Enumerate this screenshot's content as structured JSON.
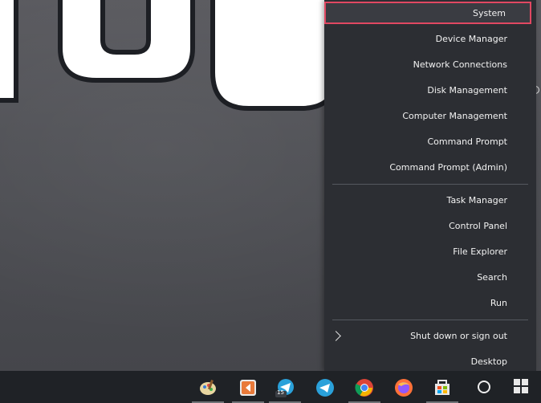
{
  "menu": {
    "items": [
      {
        "label": "System",
        "selected": true
      },
      {
        "label": "Device Manager"
      },
      {
        "label": "Network Connections"
      },
      {
        "label": "Disk Management"
      },
      {
        "label": "Computer Management"
      },
      {
        "label": "Command Prompt"
      },
      {
        "label": "Command Prompt (Admin)"
      },
      {
        "label": "Task Manager"
      },
      {
        "label": "Control Panel"
      },
      {
        "label": "File Explorer"
      },
      {
        "label": "Search"
      },
      {
        "label": "Run"
      },
      {
        "label": "Shut down or sign out",
        "has_submenu": true
      },
      {
        "label": "Desktop"
      }
    ],
    "selection_color": "#e14862",
    "background": "#2c2e33"
  },
  "taskbar": {
    "background": "#1f2226",
    "pinned": [
      {
        "icon": "paint-palette-icon"
      },
      {
        "icon": "media-player-icon"
      },
      {
        "icon": "telegram-badge-icon",
        "badge": "15"
      },
      {
        "icon": "telegram-icon"
      },
      {
        "icon": "chrome-icon"
      },
      {
        "icon": "firefox-icon"
      },
      {
        "icon": "store-icon"
      }
    ]
  }
}
